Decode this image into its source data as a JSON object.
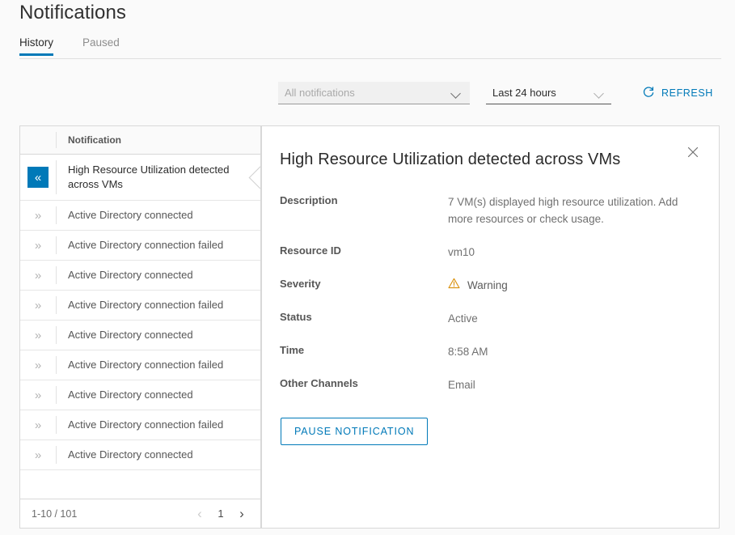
{
  "header": {
    "title": "Notifications",
    "tabs": [
      {
        "label": "History",
        "active": true
      },
      {
        "label": "Paused",
        "active": false
      }
    ]
  },
  "filters": {
    "type_filter": {
      "value": "All notifications",
      "placeholder": "All notifications"
    },
    "time_filter": {
      "value": "Last 24 hours"
    },
    "refresh_label": "REFRESH",
    "refresh_icon": "refresh-icon"
  },
  "list": {
    "column_header": "Notification",
    "rows": [
      {
        "label": "High Resource Utilization detected across VMs",
        "selected": true,
        "icon": "chevron-double-left-icon"
      },
      {
        "label": "Active Directory connected",
        "selected": false,
        "icon": "chevron-double-right-icon"
      },
      {
        "label": "Active Directory connection failed",
        "selected": false,
        "icon": "chevron-double-right-icon"
      },
      {
        "label": "Active Directory connected",
        "selected": false,
        "icon": "chevron-double-right-icon"
      },
      {
        "label": "Active Directory connection failed",
        "selected": false,
        "icon": "chevron-double-right-icon"
      },
      {
        "label": "Active Directory connected",
        "selected": false,
        "icon": "chevron-double-right-icon"
      },
      {
        "label": "Active Directory connection failed",
        "selected": false,
        "icon": "chevron-double-right-icon"
      },
      {
        "label": "Active Directory connected",
        "selected": false,
        "icon": "chevron-double-right-icon"
      },
      {
        "label": "Active Directory connection failed",
        "selected": false,
        "icon": "chevron-double-right-icon"
      },
      {
        "label": "Active Directory connected",
        "selected": false,
        "icon": "chevron-double-right-icon"
      }
    ],
    "footer": {
      "range": "1-10 / 101",
      "page": "1",
      "prev_icon": "chevron-left-icon",
      "next_icon": "chevron-right-icon"
    }
  },
  "detail": {
    "title": "High Resource Utilization detected across VMs",
    "close_icon": "close-icon",
    "fields": [
      {
        "key": "Description",
        "value": "7 VM(s) displayed high resource utilization. Add more resources or check usage."
      },
      {
        "key": "Resource ID",
        "value": "vm10"
      },
      {
        "key": "Severity",
        "value": "Warning",
        "icon": "warning-triangle-icon"
      },
      {
        "key": "Status",
        "value": "Active"
      },
      {
        "key": "Time",
        "value": "8:58 AM"
      },
      {
        "key": "Other Channels",
        "value": "Email"
      }
    ],
    "pause_button": "PAUSE NOTIFICATION"
  },
  "colors": {
    "accent": "#0079b8",
    "warning": "#d9900b",
    "text": "#565656",
    "page_bg": "#fafafa"
  }
}
